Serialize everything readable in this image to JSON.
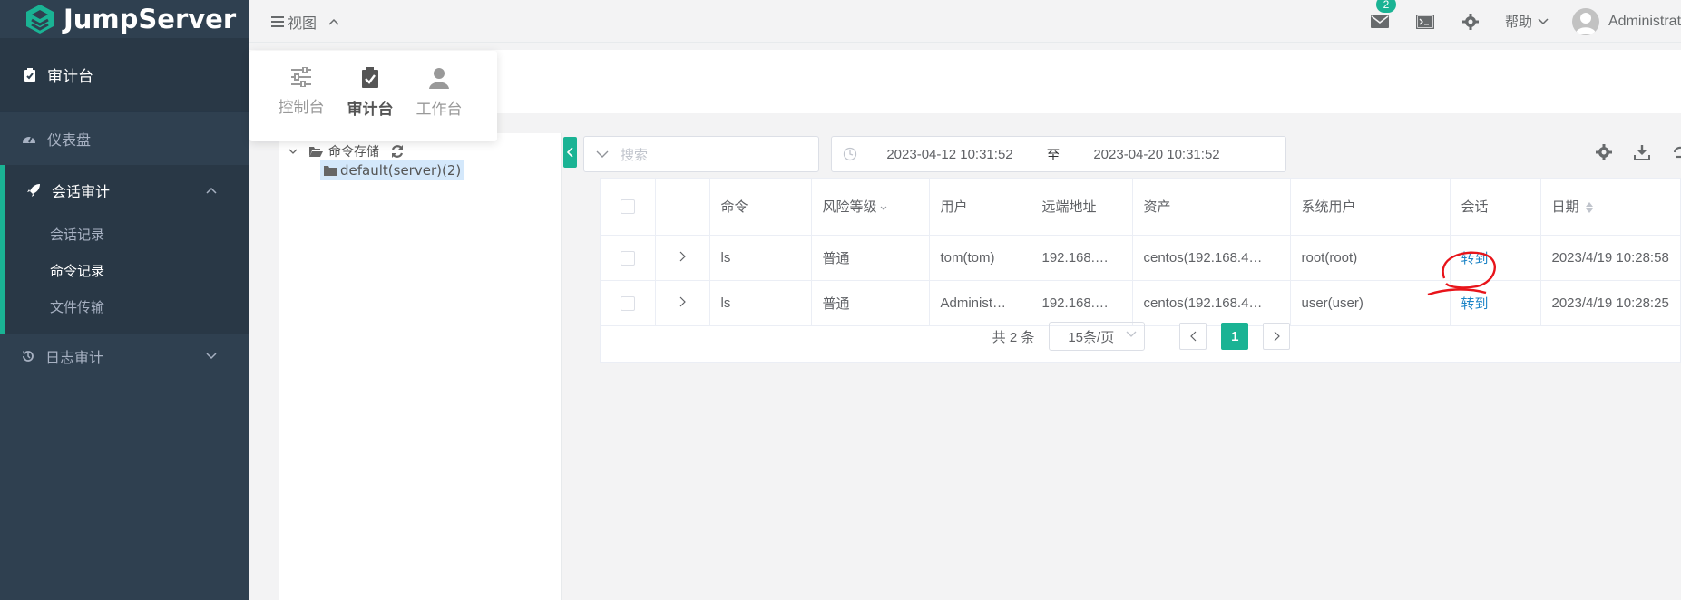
{
  "app": {
    "logo_text": "JumpServer"
  },
  "sidebar": {
    "header_label": "审计台",
    "items": [
      {
        "label": "仪表盘"
      },
      {
        "label": "会话审计",
        "children": [
          "会话记录",
          "命令记录",
          "文件传输"
        ]
      },
      {
        "label": "日志审计"
      }
    ]
  },
  "header": {
    "view_label": "视图",
    "mail_badge": "2",
    "help_label": "帮助",
    "user_name": "Administrator"
  },
  "view_popup": {
    "items": [
      "控制台",
      "审计台",
      "工作台"
    ],
    "active": "审计台"
  },
  "tree": {
    "root_label": "命令存储",
    "child_label": "default(server)(2)"
  },
  "filters": {
    "search_placeholder": "搜索",
    "date_start": "2023-04-12 10:31:52",
    "date_sep": "至",
    "date_end": "2023-04-20 10:31:52"
  },
  "table": {
    "columns": [
      "命令",
      "风险等级",
      "用户",
      "远端地址",
      "资产",
      "系统用户",
      "会话",
      "日期"
    ],
    "rows": [
      {
        "command": "ls",
        "risk": "普通",
        "user": "tom(tom)",
        "remote": "192.168.…",
        "asset": "centos(192.168.4…",
        "sys_user": "root(root)",
        "session": "转到",
        "date": "2023/4/19 10:28:58"
      },
      {
        "command": "ls",
        "risk": "普通",
        "user": "Administ…",
        "remote": "192.168.…",
        "asset": "centos(192.168.4…",
        "sys_user": "user(user)",
        "session": "转到",
        "date": "2023/4/19 10:28:25"
      }
    ]
  },
  "pagination": {
    "total_text": "共 2 条",
    "page_size": "15条/页",
    "current_page": "1"
  },
  "colors": {
    "accent": "#1ab394",
    "sidebar_bg": "#2f4050",
    "link": "#1c84c6",
    "annotation": "#e8141a"
  }
}
